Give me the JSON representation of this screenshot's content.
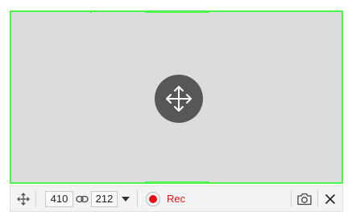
{
  "capture": {
    "move_icon": "four-way-arrow-icon"
  },
  "toolbar": {
    "drag_icon": "four-way-arrow-icon",
    "width_value": "410",
    "link_icon": "chain-link-icon",
    "height_value": "212",
    "dropdown_icon": "caret-down-icon",
    "record_icon": "record-dot-icon",
    "record_label": "Rec",
    "screenshot_icon": "camera-icon",
    "close_icon": "close-x-icon"
  },
  "colors": {
    "frame_border": "#4cf54c",
    "record": "#ee0a14",
    "record_label": "#e0141e",
    "move_handle": "#575757"
  }
}
